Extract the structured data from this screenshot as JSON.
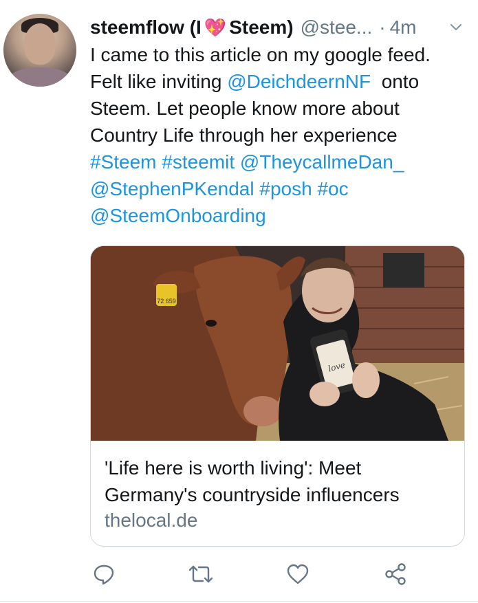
{
  "tweet": {
    "author_name": "steemflow (I",
    "author_emoji": "💖",
    "author_name_suffix": "Steem)",
    "handle": "@stee...",
    "separator": "·",
    "time": "4m",
    "text_lines": [
      {
        "plain": "I came to this article on my google feed.",
        "link": ""
      },
      {
        "plain": "Felt like inviting ",
        "link": "@DeichdeernNF",
        "after": "  onto"
      },
      {
        "plain": "Steem. Let people know more about",
        "link": ""
      },
      {
        "plain": "Country Life through her experience",
        "link": ""
      },
      {
        "plain": "",
        "link": "#Steem #steemit @TheycallmeDan_"
      },
      {
        "plain": "",
        "link": "@StephenPKendal #posh #oc"
      },
      {
        "plain": "",
        "link": "@SteemOnboarding"
      }
    ]
  },
  "card": {
    "title_line1": "'Life here is worth living': Meet",
    "title_line2": "Germany's countryside influencers",
    "domain": "thelocal.de",
    "ear_tag": "72 659",
    "phone_text": "love"
  },
  "actions": [
    "reply-icon",
    "retweet-icon",
    "like-icon",
    "share-icon"
  ],
  "colors": {
    "link": "#1b95e0",
    "secondary": "#657786",
    "border": "#cfd9de"
  }
}
